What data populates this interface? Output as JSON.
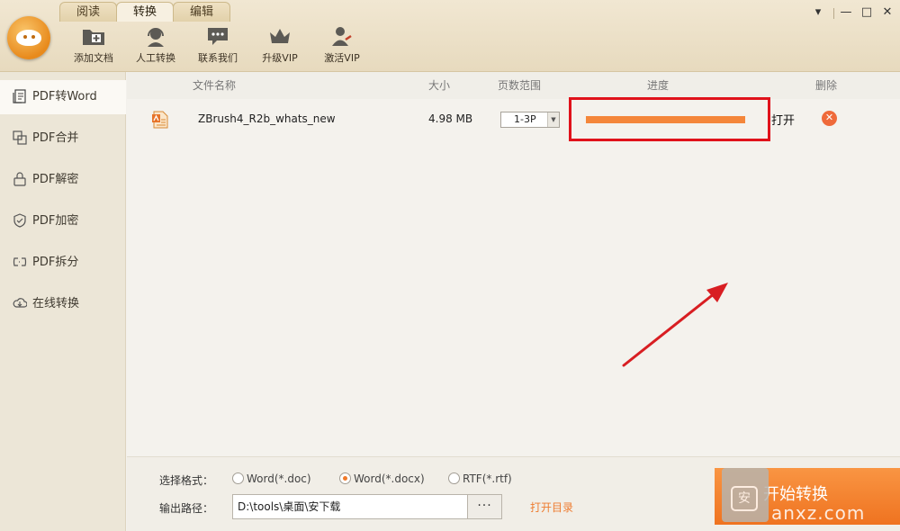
{
  "tabs": [
    {
      "label": "阅读",
      "active": false
    },
    {
      "label": "转换",
      "active": true
    },
    {
      "label": "编辑",
      "active": false
    }
  ],
  "toolbar": [
    {
      "label": "添加文档",
      "icon": "add-folder-icon"
    },
    {
      "label": "人工转换",
      "icon": "headset-icon"
    },
    {
      "label": "联系我们",
      "icon": "chat-icon"
    },
    {
      "label": "升级VIP",
      "icon": "crown-icon"
    },
    {
      "label": "激活VIP",
      "icon": "user-key-icon"
    }
  ],
  "window_controls": {
    "menu": "▾",
    "minimize": "—",
    "maximize": "□",
    "close": "✕"
  },
  "sidebar": {
    "items": [
      {
        "label": "PDF转Word",
        "icon": "pdf-to-word-icon",
        "active": true
      },
      {
        "label": "PDF合并",
        "icon": "merge-icon"
      },
      {
        "label": "PDF解密",
        "icon": "unlock-icon"
      },
      {
        "label": "PDF加密",
        "icon": "shield-icon"
      },
      {
        "label": "PDF拆分",
        "icon": "split-icon"
      },
      {
        "label": "在线转换",
        "icon": "cloud-icon"
      }
    ]
  },
  "table": {
    "headers": {
      "filename": "文件名称",
      "size": "大小",
      "pages": "页数范围",
      "progress": "进度",
      "delete": "删除"
    },
    "row": {
      "filename": "ZBrush4_R2b_whats_new",
      "size": "4.98 MB",
      "pages": "1-3P",
      "progress": 1.0,
      "open": "打开"
    }
  },
  "bottom": {
    "format_label": "选择格式：",
    "formats": [
      {
        "label": "Word(*.doc)",
        "selected": false
      },
      {
        "label": "Word(*.docx)",
        "selected": true
      },
      {
        "label": "RTF(*.rtf)",
        "selected": false
      }
    ],
    "path_label": "输出路径：",
    "path_value": "D:\\tools\\桌面\\安下载",
    "browse": "···",
    "open_dir": "打开目录",
    "start": "开始转换"
  },
  "watermark": {
    "icon_text": "安",
    "text": "anxz.com"
  },
  "colors": {
    "accent": "#f07a2a",
    "highlight": "#e0121b",
    "progress": "#f4863a"
  }
}
